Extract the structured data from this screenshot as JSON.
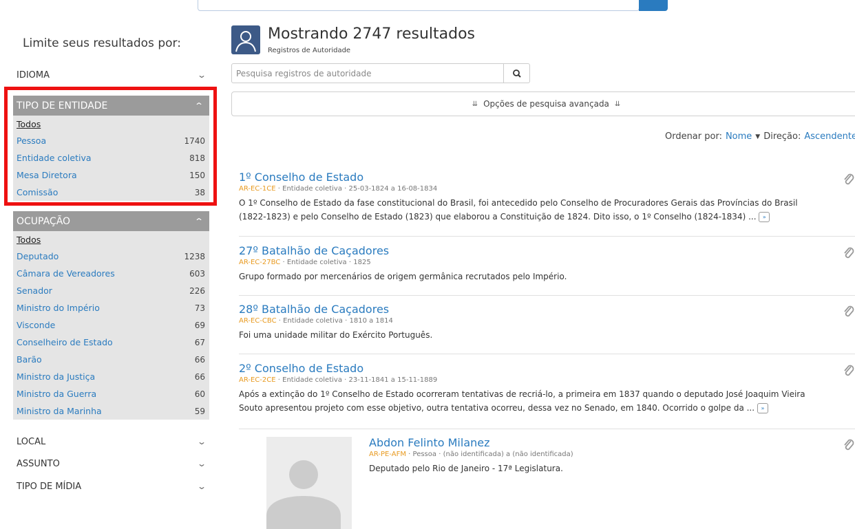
{
  "sidebar": {
    "title": "Limite seus resultados por:",
    "collapsed_top": {
      "label": "IDIOMA"
    },
    "facets": [
      {
        "label": "TIPO DE ENTIDADE",
        "todos": "Todos",
        "items": [
          {
            "label": "Pessoa",
            "count": "1740"
          },
          {
            "label": "Entidade coletiva",
            "count": "818"
          },
          {
            "label": "Mesa Diretora",
            "count": "150"
          },
          {
            "label": "Comissão",
            "count": "38"
          }
        ]
      },
      {
        "label": "OCUPAÇÃO",
        "todos": "Todos",
        "items": [
          {
            "label": "Deputado",
            "count": "1238"
          },
          {
            "label": "Câmara de Vereadores",
            "count": "603"
          },
          {
            "label": "Senador",
            "count": "226"
          },
          {
            "label": "Ministro do Império",
            "count": "73"
          },
          {
            "label": "Visconde",
            "count": "69"
          },
          {
            "label": "Conselheiro de Estado",
            "count": "67"
          },
          {
            "label": "Barão",
            "count": "66"
          },
          {
            "label": "Ministro da Justiça",
            "count": "66"
          },
          {
            "label": "Ministro da Guerra",
            "count": "60"
          },
          {
            "label": "Ministro da Marinha",
            "count": "59"
          }
        ]
      }
    ],
    "collapsed_bottom": [
      {
        "label": "LOCAL"
      },
      {
        "label": "ASSUNTO"
      },
      {
        "label": "TIPO DE MÍDIA"
      }
    ]
  },
  "header": {
    "title": "Mostrando 2747 resultados",
    "subtitle": "Registros de Autoridade"
  },
  "search": {
    "placeholder": "Pesquisa registros de autoridade"
  },
  "advanced": {
    "label": "Opções de pesquisa avançada"
  },
  "sort": {
    "sort_label": "Ordenar por:",
    "sort_value": "Nome",
    "direction_label": "Direção:",
    "direction_value": "Ascendente"
  },
  "results": [
    {
      "title": "1º Conselho de Estado",
      "id": "AR-EC-1CE",
      "type": "Entidade coletiva",
      "dates": "25-03-1824 a 16-08-1834",
      "desc_line1": "O 1º Conselho de Estado da fase constitucional do Brasil, foi antecedido pelo Conselho de Procuradores Gerais das Províncias do Brasil",
      "desc_line2": "(1822-1823) e pelo Conselho de Estado (1823) que elaborou a Constituição de 1824. Dito isso, o 1º Conselho (1824-1834) ..."
    },
    {
      "title": "27º Batalhão de Caçadores",
      "id": "AR-EC-27BC",
      "type": "Entidade coletiva",
      "dates": "1825",
      "desc_line1": "Grupo formado por mercenários de origem germânica recrutados pelo Império."
    },
    {
      "title": "28º Batalhão de Caçadores",
      "id": "AR-EC-CBC",
      "type": "Entidade coletiva",
      "dates": "1810 a 1814",
      "desc_line1": "Foi uma unidade militar do Exército Português."
    },
    {
      "title": "2º Conselho de Estado",
      "id": "AR-EC-2CE",
      "type": "Entidade coletiva",
      "dates": "23-11-1841 a 15-11-1889",
      "desc_line1": "Após a extinção do 1º Conselho de Estado ocorreram tentativas de recriá-lo, a primeira em 1837 quando o deputado José Joaquim Vieira",
      "desc_line2": "Souto apresentou projeto com esse objetivo, outra tentativa ocorreu, dessa vez no Senado, em 1840. Ocorrido o golpe da ..."
    },
    {
      "title": "Abdon Felinto Milanez",
      "id": "AR-PE-AFM",
      "type": "Pessoa",
      "dates": "(não identificada) a (não identificada)",
      "desc_line1": "Deputado pelo Rio de Janeiro - 17ª Legislatura."
    }
  ],
  "more_glyph": "»",
  "meta_sep": "·",
  "colors": {
    "link": "#2a7bbf",
    "facet_header": "#9b9b9b",
    "facet_bg": "#e5e5e5",
    "highlight": "#ee1111",
    "id_orange": "#e89a20"
  }
}
